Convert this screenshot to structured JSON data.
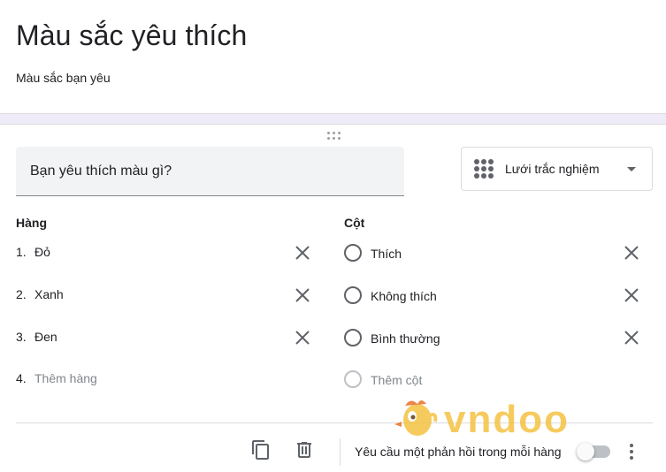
{
  "form": {
    "title": "Màu sắc yêu thích",
    "description": "Màu sắc bạn yêu"
  },
  "question": {
    "text": "Bạn yêu thích màu gì?",
    "type_label": "Lưới trắc nghiệm"
  },
  "rows": {
    "heading": "Hàng",
    "items": [
      {
        "num": "1.",
        "label": "Đỏ"
      },
      {
        "num": "2.",
        "label": "Xanh"
      },
      {
        "num": "3.",
        "label": "Đen"
      }
    ],
    "add": {
      "num": "4.",
      "label": "Thêm hàng"
    }
  },
  "columns": {
    "heading": "Cột",
    "items": [
      {
        "label": "Thích"
      },
      {
        "label": "Không thích"
      },
      {
        "label": "Bình thường"
      }
    ],
    "add": {
      "label": "Thêm cột"
    }
  },
  "footer": {
    "required_label": "Yêu cầu một phản hồi trong mỗi hàng",
    "required_on": false
  },
  "watermark": {
    "text": "vndoo"
  },
  "colors": {
    "accent_band": "#f0ebf8",
    "watermark": "#f5c242",
    "icon": "#5f6368"
  }
}
